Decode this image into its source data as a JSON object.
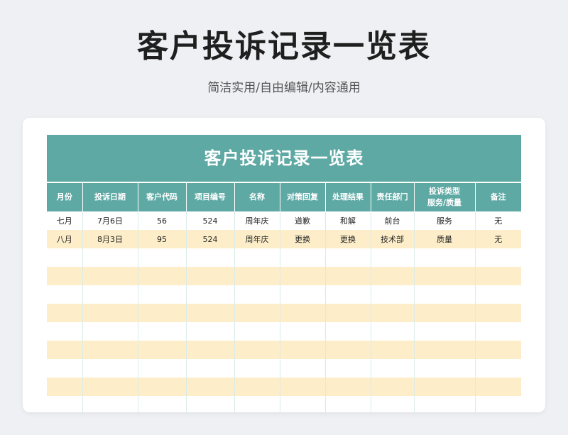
{
  "header": {
    "title": "客户投诉记录一览表",
    "subtitle": "简洁实用/自由编辑/内容通用"
  },
  "sheet": {
    "title": "客户投诉记录一览表",
    "columns": [
      "月份",
      "投诉日期",
      "客户代码",
      "项目编号",
      "名称",
      "对策回复",
      "处理结果",
      "责任部门",
      "投诉类型\n服务/质量",
      "备注"
    ],
    "rows": [
      [
        "七月",
        "7月6日",
        "56",
        "524",
        "周年庆",
        "道歉",
        "和解",
        "前台",
        "服务",
        "无"
      ],
      [
        "八月",
        "8月3日",
        "95",
        "524",
        "周年庆",
        "更换",
        "更换",
        "技术部",
        "质量",
        "无"
      ],
      [
        "",
        "",
        "",
        "",
        "",
        "",
        "",
        "",
        "",
        ""
      ],
      [
        "",
        "",
        "",
        "",
        "",
        "",
        "",
        "",
        "",
        ""
      ],
      [
        "",
        "",
        "",
        "",
        "",
        "",
        "",
        "",
        "",
        ""
      ],
      [
        "",
        "",
        "",
        "",
        "",
        "",
        "",
        "",
        "",
        ""
      ],
      [
        "",
        "",
        "",
        "",
        "",
        "",
        "",
        "",
        "",
        ""
      ],
      [
        "",
        "",
        "",
        "",
        "",
        "",
        "",
        "",
        "",
        ""
      ],
      [
        "",
        "",
        "",
        "",
        "",
        "",
        "",
        "",
        "",
        ""
      ],
      [
        "",
        "",
        "",
        "",
        "",
        "",
        "",
        "",
        "",
        ""
      ],
      [
        "",
        "",
        "",
        "",
        "",
        "",
        "",
        "",
        "",
        ""
      ]
    ]
  },
  "colors": {
    "header_bg": "#5ea9a4",
    "stripe": "#fdeec9",
    "page_bg": "#eef0f4"
  }
}
